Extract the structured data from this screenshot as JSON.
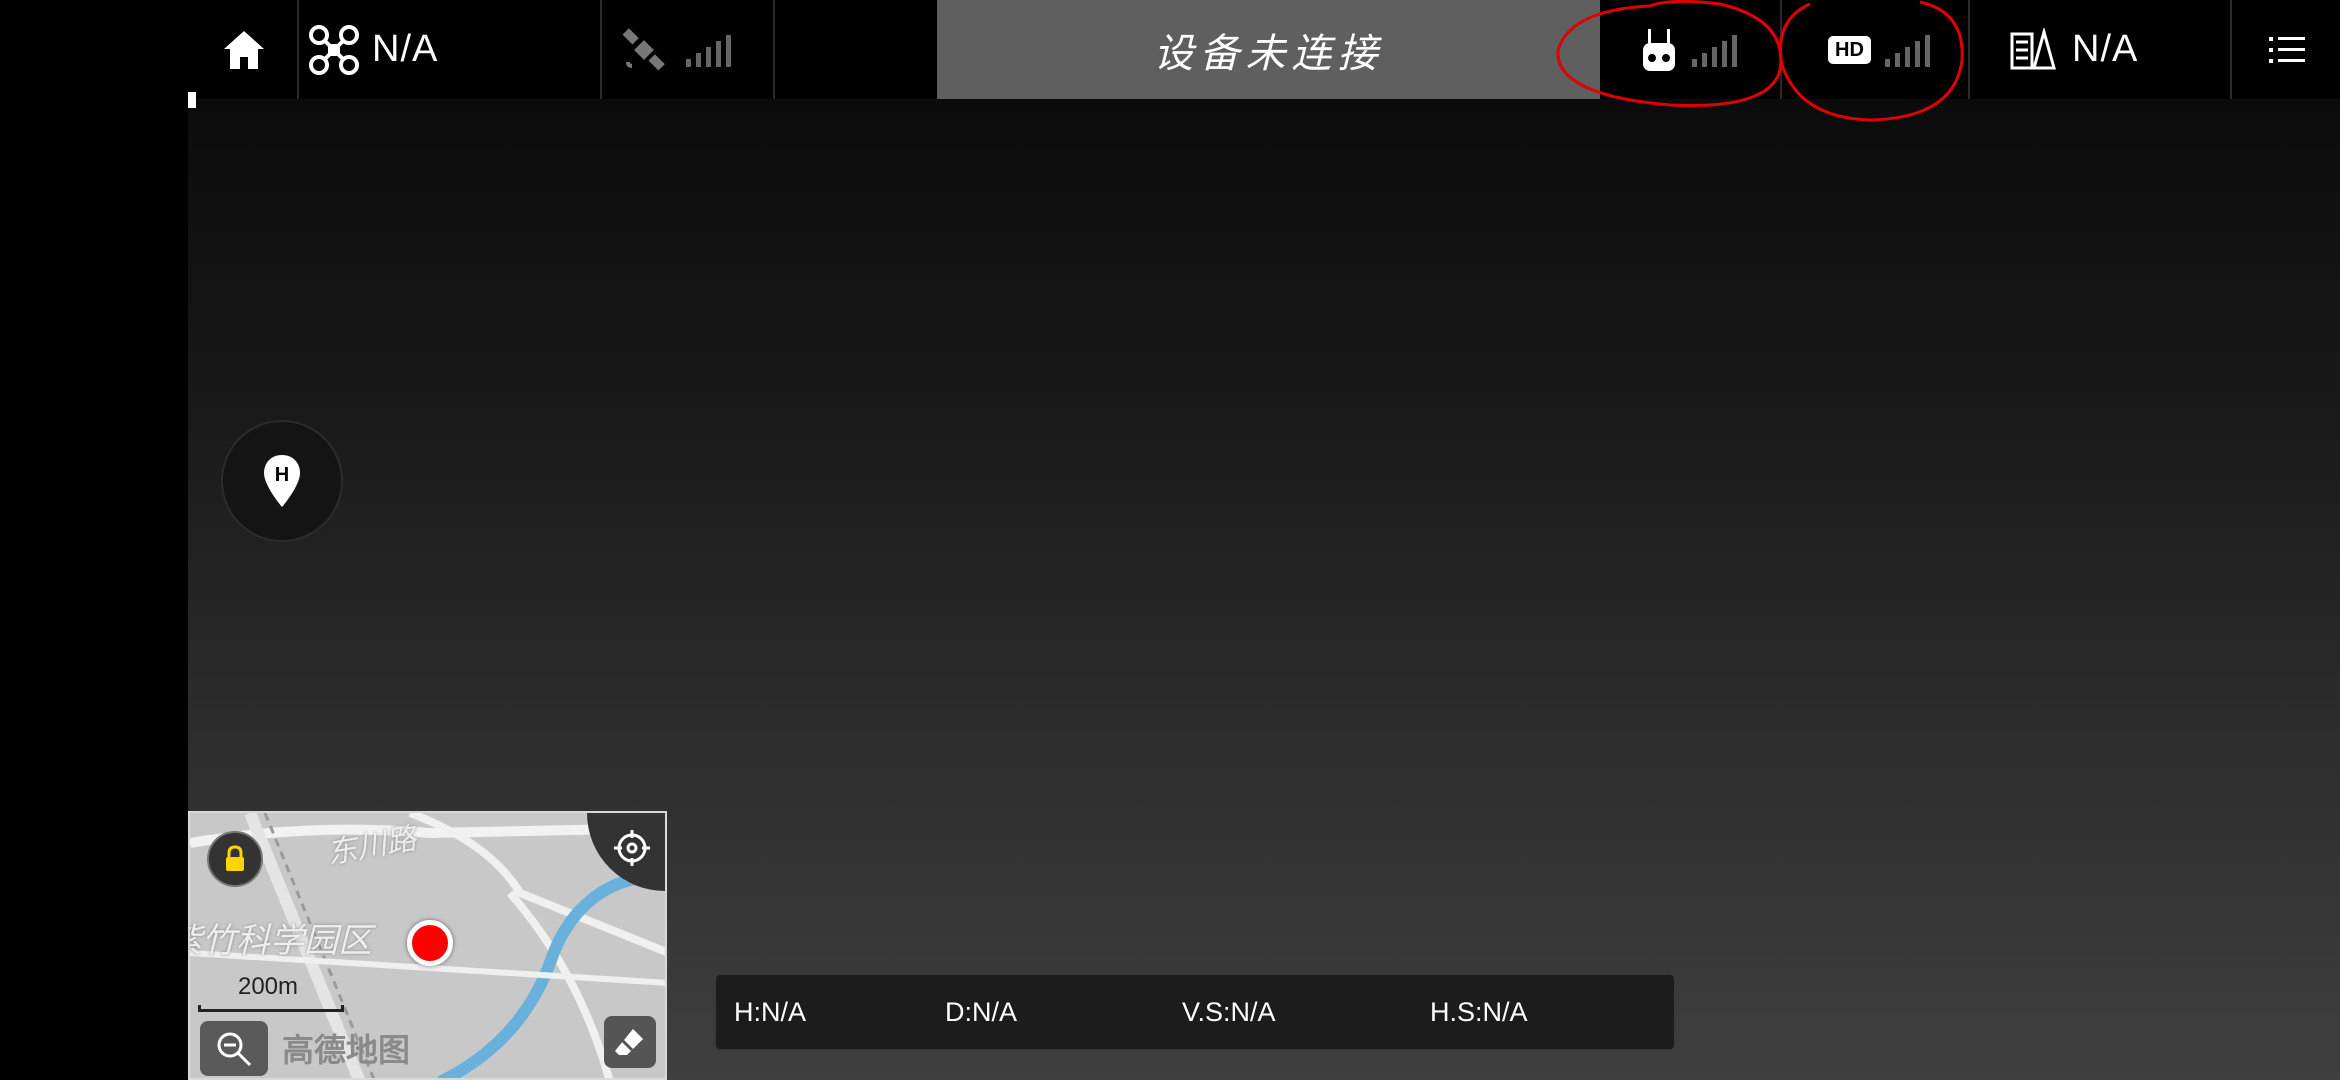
{
  "topbar": {
    "home_icon": "home-icon",
    "aircraft": {
      "icon": "drone-icon",
      "label": "N/A"
    },
    "gps": {
      "icon": "satellite-icon",
      "signal": "no-signal"
    },
    "status_banner": "设备未连接",
    "remote_controller": {
      "icon": "remote-controller-icon",
      "signal": "no-signal"
    },
    "hd_link": {
      "badge": "HD",
      "signal": "no-signal"
    },
    "flight_mode": {
      "icon": "checklist-icon",
      "label": "N/A"
    },
    "menu_icon": "menu-icon"
  },
  "map": {
    "road_label": "东川路",
    "area_label": "紫竹科学园区",
    "scale": "200m",
    "provider": "高德地图"
  },
  "home_point": {
    "letter": "H"
  },
  "telemetry": {
    "height": "H:N/A",
    "distance": "D:N/A",
    "vertical_speed": "V.S:N/A",
    "horizontal_speed": "H.S:N/A"
  },
  "colors": {
    "banner": "#5f5f5f",
    "annotation": "#e00000",
    "aircraft_dot": "#ff0000"
  }
}
